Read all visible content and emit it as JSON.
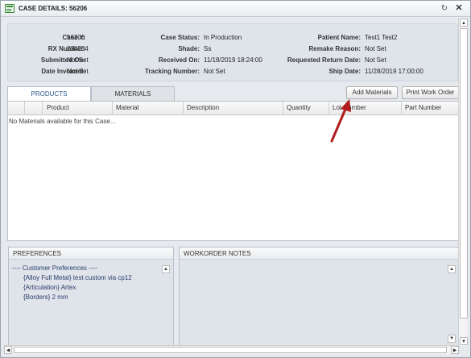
{
  "window": {
    "title": "CASE DETAILS: 56206",
    "refresh_icon": "↻",
    "close_icon": "✕"
  },
  "details": {
    "col1": [
      {
        "label": "Case #:",
        "value": "56206"
      },
      {
        "label": "RX Number:",
        "value": "234234"
      },
      {
        "label": "Submitted On:",
        "value": "Not Set"
      },
      {
        "label": "Date Invoiced:",
        "value": "Not Set"
      }
    ],
    "col2": [
      {
        "label": "Case Status:",
        "value": "In Production"
      },
      {
        "label": "Shade:",
        "value": "Ss"
      },
      {
        "label": "Received On:",
        "value": "11/18/2019 18:24:00"
      },
      {
        "label": "Tracking Number:",
        "value": "Not Set"
      }
    ],
    "col3": [
      {
        "label": "Patient Name:",
        "value": "Test1 Test2"
      },
      {
        "label": "Remake Reason:",
        "value": "Not Set"
      },
      {
        "label": "Requested Return Date:",
        "value": "Not Set"
      },
      {
        "label": "Ship Date:",
        "value": "11/28/2019 17:00:00"
      }
    ]
  },
  "tabs": [
    {
      "label": "PRODUCTS",
      "active": true
    },
    {
      "label": "MATERIALS",
      "active": false
    }
  ],
  "toolbar": {
    "add_materials_label": "Add Materials",
    "print_work_order_label": "Print Work Order"
  },
  "grid": {
    "columns": [
      "",
      "",
      "Product",
      "Material",
      "Description",
      "Quantity",
      "Lot Number",
      "Part Number"
    ],
    "empty_message": "No Materials available for this Case..."
  },
  "preferences": {
    "title": "PREFERENCES",
    "header_line": "---- Customer Preferences ----",
    "items": [
      "{Alloy Full Metal} test custom via cp12",
      "{Articulation} Artex",
      "{Borders} 2 mm"
    ]
  },
  "workorder_notes": {
    "title": "WORKORDER NOTES"
  },
  "colors": {
    "arrow": "#b01c1c",
    "active_tab_text": "#2b5a8a"
  }
}
